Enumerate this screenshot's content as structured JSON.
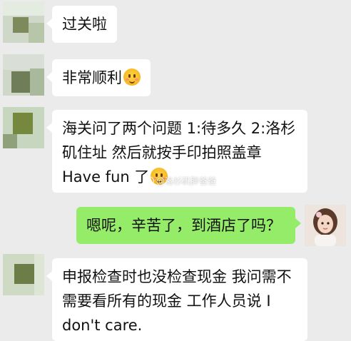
{
  "messages": [
    {
      "side": "left",
      "text": "过关啦",
      "emoji": false
    },
    {
      "side": "left",
      "text": "非常顺利",
      "emoji": true,
      "emoji_icon": "smiling-face-emoji"
    },
    {
      "side": "left",
      "lines": [
        "海关问了两个问题 1:待多久 2:洛杉",
        "矶住址 然后就按手印拍照盖章",
        "Have fun 了"
      ],
      "emoji": true,
      "emoji_icon": "smiling-face-emoji"
    },
    {
      "side": "right",
      "text": "嗯呢，辛苦了，到酒店了吗？",
      "emoji": false
    },
    {
      "side": "left",
      "lines": [
        "申报检查时也没检查现金 我问需不",
        "需要看所有的现金 工作人员说 I",
        "don't care."
      ],
      "emoji": false
    }
  ],
  "watermark": "@洛杉矶胖爸爸",
  "colors": {
    "background": "#ebebeb",
    "incoming_bubble": "#ffffff",
    "outgoing_bubble": "#95ec69"
  }
}
